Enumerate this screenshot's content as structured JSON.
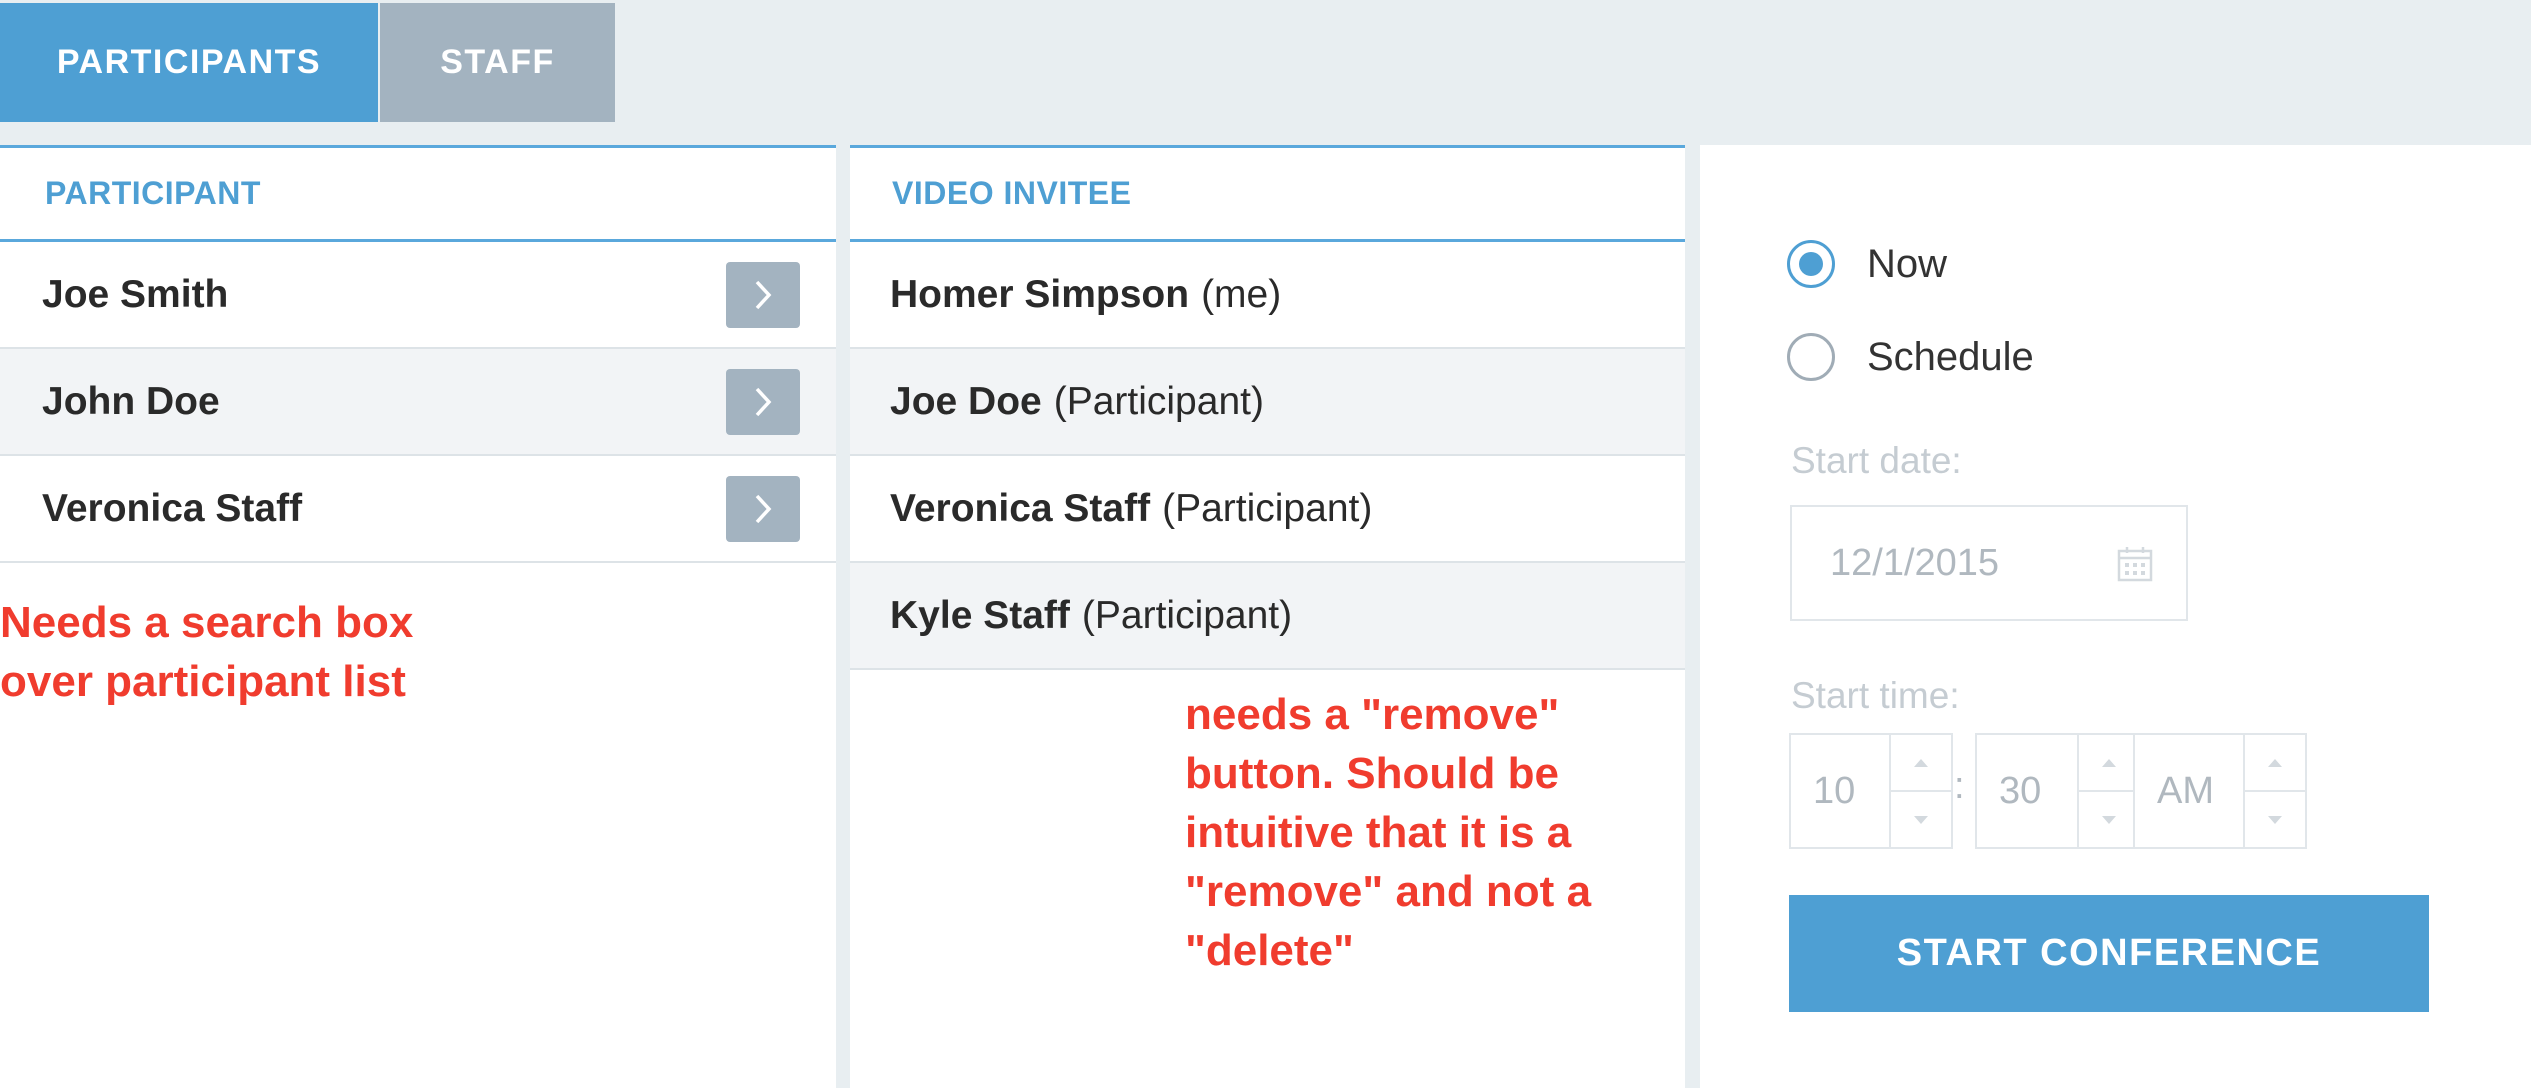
{
  "tabs": [
    {
      "label": "PARTICIPANTS",
      "active": true
    },
    {
      "label": "STAFF",
      "active": false
    }
  ],
  "participant_panel": {
    "header": "PARTICIPANT",
    "rows": [
      {
        "name": "Joe Smith"
      },
      {
        "name": "John Doe"
      },
      {
        "name": "Veronica Staff"
      }
    ],
    "row_action_icon": "chevron-right-icon"
  },
  "invitee_panel": {
    "header": "VIDEO INVITEE",
    "rows": [
      {
        "name": "Homer Simpson",
        "role": "(me)"
      },
      {
        "name": "Joe Doe",
        "role": "(Participant)"
      },
      {
        "name": "Veronica Staff",
        "role": "(Participant)"
      },
      {
        "name": "Kyle Staff",
        "role": "(Participant)"
      }
    ]
  },
  "annotations": {
    "left": [
      "Needs a search box",
      "over participant list"
    ],
    "middle": [
      "needs a \"remove\"",
      "button. Should be",
      "intuitive that it is a",
      "\"remove\" and not a",
      "\"delete\""
    ]
  },
  "schedule": {
    "options": [
      {
        "label": "Now",
        "selected": true
      },
      {
        "label": "Schedule",
        "selected": false
      }
    ],
    "start_date_label": "Start date:",
    "start_date_value": "12/1/2015",
    "start_time_label": "Start time:",
    "hour": "10",
    "separator": ":",
    "minute": "30",
    "ampm": "AM",
    "start_button": "START CONFERENCE"
  },
  "colors": {
    "accent": "#4e9fd3",
    "inactive_tab": "#a3b3c0",
    "annotation": "#f03c2e",
    "background": "#e8eef1"
  }
}
